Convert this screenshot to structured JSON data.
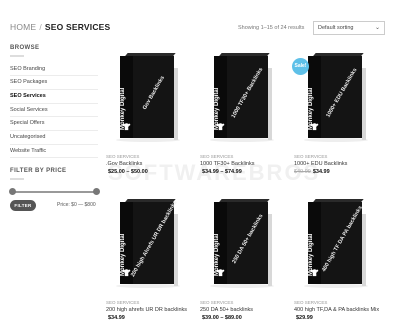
{
  "breadcrumb": {
    "home": "HOME",
    "separator": "/",
    "current": "SEO SERVICES"
  },
  "results_text": "Showing 1–15 of 24 results",
  "sort": {
    "selected": "Default sorting",
    "arrow_icon": "chevron-down-icon"
  },
  "sidebar": {
    "browse_title": "BROWSE",
    "categories": [
      {
        "label": "SEO Branding",
        "active": false
      },
      {
        "label": "SEO Packages",
        "active": false
      },
      {
        "label": "SEO Services",
        "active": true
      },
      {
        "label": "Social Services",
        "active": false
      },
      {
        "label": "Special Offers",
        "active": false
      },
      {
        "label": "Uncategorised",
        "active": false
      },
      {
        "label": "Website Traffic",
        "active": false
      }
    ],
    "filter_title": "FILTER BY PRICE",
    "filter_button": "FILTER",
    "price_label": "Price: $0 — $800",
    "price_range": {
      "min_fraction": 0.0,
      "max_fraction": 1.0
    }
  },
  "product_brand": "Monkey Digital",
  "watermark": "SOFTWAREBROS",
  "products": [
    {
      "category": "SEO SERVICES",
      "name": ".Gov Backlinks",
      "old_price": "",
      "price": "$25.00 – $50.00",
      "box_label": "Gov Backlinks",
      "sale": false
    },
    {
      "category": "SEO SERVICES",
      "name": "1000 TF30+ Backlinks",
      "old_price": "",
      "price": "$34.99 – $74.99",
      "box_label": "1000 TF30+ Backlinks",
      "sale": false
    },
    {
      "category": "SEO SERVICES",
      "name": "1000+ EDU Backlinks",
      "old_price": "$49.99",
      "price": "$34.99",
      "box_label": "1000+ EDU Backlinks",
      "sale": true,
      "sale_label": "Sale!"
    },
    {
      "category": "SEO SERVICES",
      "name": "200 high ahrefs UR DR backlinks",
      "old_price": "",
      "price": "$34.99",
      "box_label": "200 high Ahrefs UR DR backlinks",
      "sale": false
    },
    {
      "category": "SEO SERVICES",
      "name": "250 DA 50+ backlinks",
      "old_price": "",
      "price": "$39.00 – $89.00",
      "box_label": "250 DA 50+ backlinks",
      "sale": false
    },
    {
      "category": "SEO SERVICES",
      "name": "400 high TF,DA & PA backlinks Mix",
      "old_price": "",
      "price": "$29.99",
      "box_label": "400 high TF DA PA backlinks",
      "sale": false
    }
  ]
}
